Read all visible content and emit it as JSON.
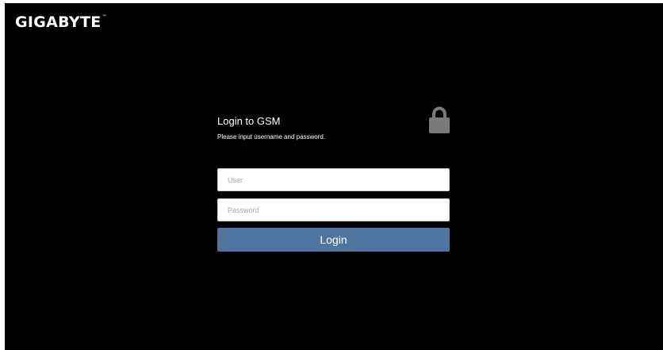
{
  "brand": {
    "logo_text": "GIGABYTE",
    "trademark": "™"
  },
  "login": {
    "title": "Login to GSM",
    "subtitle": "Please input username and password.",
    "lock_icon": "lock-icon",
    "username": {
      "placeholder": "User",
      "value": ""
    },
    "password": {
      "placeholder": "Password",
      "value": ""
    },
    "button_label": "Login"
  },
  "colors": {
    "background": "#000000",
    "button": "#4d75a0",
    "lock": "#7a7a7a",
    "text": "#ffffff"
  }
}
